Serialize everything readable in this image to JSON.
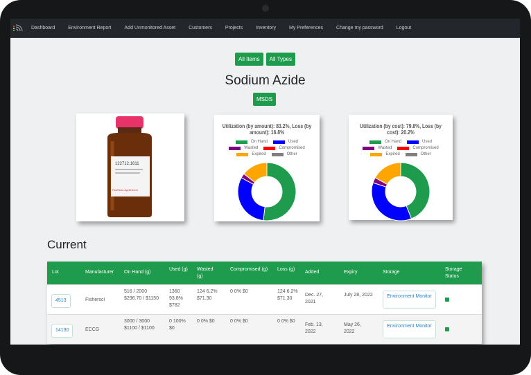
{
  "nav": {
    "items": [
      "Dashboard",
      "Environment Report",
      "Add Unmonitored Asset",
      "Customers",
      "Projects",
      "Inventory",
      "My Preferences",
      "Change my password",
      "Logout"
    ]
  },
  "filters": {
    "all_items": "All Items",
    "all_types": "All Types"
  },
  "page_title": "Sodium Azide",
  "msds_label": "MSDS",
  "colors": {
    "on_hand": "#1e9b4c",
    "used": "#0000ff",
    "wasted": "#800080",
    "compromised": "#ff0000",
    "expired": "#ffa500",
    "other": "#808080",
    "accent": "#1e9b4c"
  },
  "chart_data": [
    {
      "type": "pie",
      "title": "Utilization (by amount): 83.2%, Loss (by amount): 16.8%",
      "legend_position": "top",
      "categories": [
        "On Hand",
        "Used",
        "Wasted",
        "Compromised",
        "Expired",
        "Other"
      ],
      "values": [
        52,
        31,
        2.5,
        0,
        14.5,
        0
      ]
    },
    {
      "type": "pie",
      "title": "Utilization (by cost): 79.8%, Loss (by cost): 20.2%",
      "legend_position": "top",
      "categories": [
        "On Hand",
        "Used",
        "Wasted",
        "Compromised",
        "Expired",
        "Other"
      ],
      "values": [
        44,
        36,
        3,
        0,
        17,
        0
      ]
    }
  ],
  "section_title": "Current",
  "table": {
    "headers": [
      "Lot",
      "Manufacturer",
      "On Hand (g)",
      "Used (g)",
      "Wasted (g)",
      "Compromised (g)",
      "Loss (g)",
      "Added",
      "Expiry",
      "Storage",
      "Storage Status"
    ],
    "rows": [
      {
        "lot": "4513",
        "manufacturer": "Fishersci",
        "on_hand": "516 / 2000 $296.70 / $1150",
        "used": "1360 93.8% $782",
        "wasted": "124 6.2% $71.30",
        "compromised": "0 0% $0",
        "loss": "124 6.2% $71.30",
        "added": "Dec. 27, 2021",
        "expiry": "July 28, 2022",
        "storage": "Environment Monitor"
      },
      {
        "lot": "14130",
        "manufacturer": "ECCG",
        "on_hand": "3000 / 3000 $1100 / $1100",
        "used": "0 100% $0",
        "wasted": "0 0% $0",
        "compromised": "0 0% $0",
        "loss": "0 0% $0",
        "added": "Feb. 13, 2022",
        "expiry": "May 26, 2022",
        "storage": "Environment Monitor"
      }
    ]
  }
}
